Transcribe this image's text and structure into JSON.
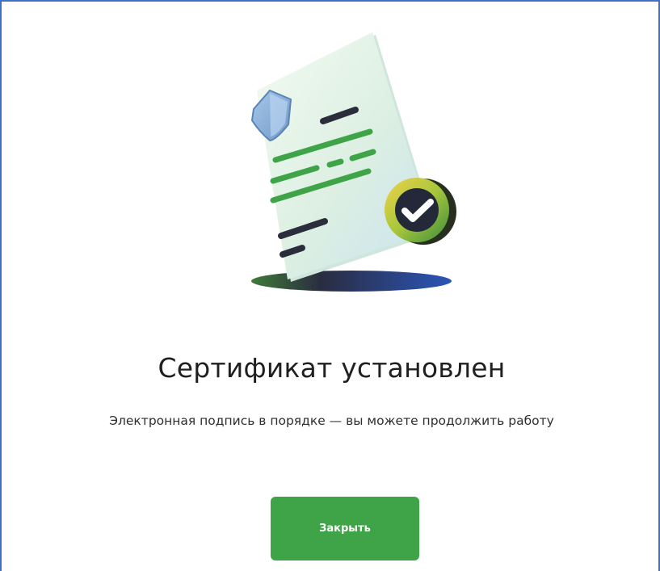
{
  "dialog": {
    "title": "Сертификат установлен",
    "message": "Электронная подпись в порядке — вы можете продолжить работу",
    "close_label": "Закрыть"
  },
  "illustration": {
    "icons": [
      "document-icon",
      "shield-icon",
      "checkmark-badge-icon"
    ]
  },
  "colors": {
    "frame_border": "#3f6fc7",
    "accent_green": "#3ea447",
    "text_primary": "#1f1f1f",
    "text_secondary": "#2e2e2e",
    "document_tint": "#dff3ec",
    "shield_blue": "#8fb6df",
    "shadow_blue": "#2b55b8"
  }
}
